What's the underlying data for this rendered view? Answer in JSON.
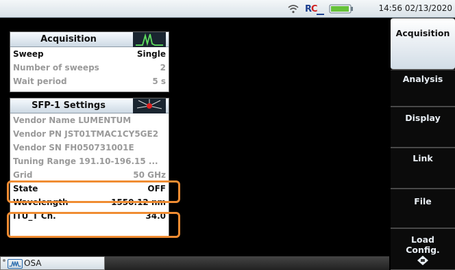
{
  "status": {
    "clock": "14:56 02/13/2020",
    "wifi_icon": "wifi-icon",
    "remote_icon": "remote-control-icon",
    "battery_icon": "battery-icon"
  },
  "acquisition_panel": {
    "title": "Acquisition",
    "icon": "spectrum-icon",
    "rows": [
      {
        "label": "Sweep",
        "value": "Single"
      },
      {
        "label": "Number of sweeps",
        "value": "2"
      },
      {
        "label": "Wait period",
        "value": "5 s"
      }
    ]
  },
  "sfp_panel": {
    "title": "SFP-1 Settings",
    "icon": "laser-icon",
    "vendor_name": "Vendor Name   LUMENTUM",
    "vendor_pn": "Vendor PN  JST01TMAC1CY5GE2",
    "vendor_sn": "Vendor SN     FH050731001E",
    "tuning_range": "Tuning Range  191.10-196.15 ...",
    "grid": {
      "label": "Grid",
      "value": "50 GHz"
    },
    "state": {
      "label": "State",
      "value": "OFF"
    },
    "wavelength": {
      "label": "Wavelength",
      "value": "1550.12 nm"
    },
    "itu_channel": {
      "label": "ITU_T Ch.",
      "value": "34.0"
    }
  },
  "sidebar": {
    "buttons": [
      {
        "label": "Acquisition",
        "active": true
      },
      {
        "label": "Analysis"
      },
      {
        "label": "Display"
      },
      {
        "label": "Link"
      },
      {
        "label": "File"
      },
      {
        "label": "Load",
        "label2": "Config."
      }
    ]
  },
  "bottom": {
    "tab_label": "OSA",
    "tab_icon": "osa-wave-icon"
  },
  "colors": {
    "highlight": "#f08c32",
    "background": "#000000",
    "panel_header": "#cdd9e4"
  }
}
